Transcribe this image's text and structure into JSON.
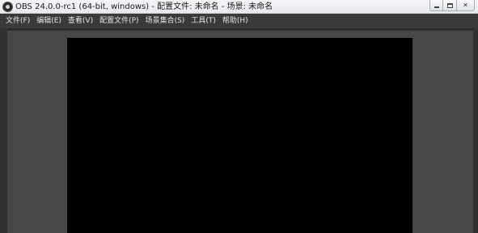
{
  "window": {
    "title": "OBS 24.0.0-rc1 (64-bit, windows) - 配置文件: 未命名 - 场景: 未命名",
    "app_icon": "obs-logo-icon",
    "controls": {
      "minimize_icon": "minimize-icon",
      "maximize_icon": "maximize-icon",
      "close_label": "✕"
    }
  },
  "menu": {
    "items": [
      {
        "label": "文件(F)"
      },
      {
        "label": "编辑(E)"
      },
      {
        "label": "查看(V)"
      },
      {
        "label": "配置文件(P)"
      },
      {
        "label": "场景集合(S)"
      },
      {
        "label": "工具(T)"
      },
      {
        "label": "帮助(H)"
      }
    ]
  },
  "colors": {
    "menubar": "#3a3a3a",
    "preview_background": "#474747",
    "canvas": "#000000",
    "menu_text": "#e6e6e6"
  }
}
